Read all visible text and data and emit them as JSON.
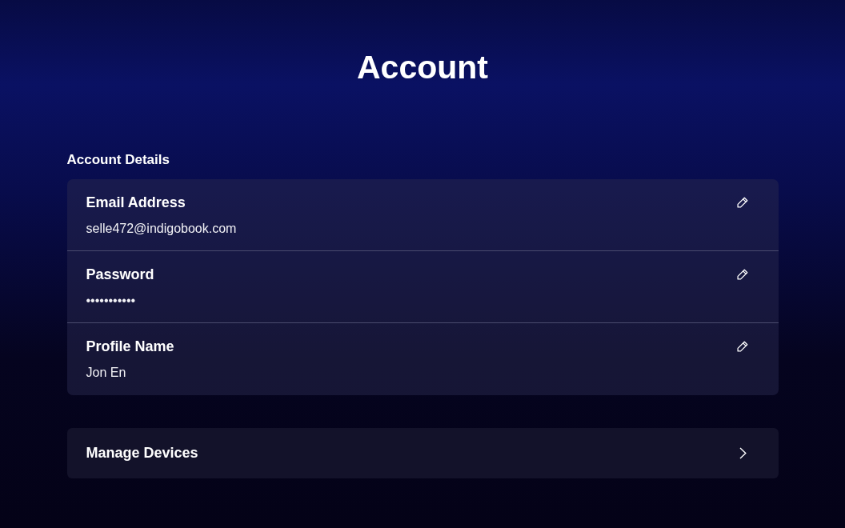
{
  "page": {
    "title": "Account"
  },
  "account_details": {
    "heading": "Account Details",
    "fields": [
      {
        "label": "Email Address",
        "value": "selle472@indigobook.com"
      },
      {
        "label": "Password",
        "value": "•••••••••••"
      },
      {
        "label": "Profile Name",
        "value": "Jon En"
      }
    ]
  },
  "links": [
    {
      "label": "Manage Devices"
    }
  ]
}
